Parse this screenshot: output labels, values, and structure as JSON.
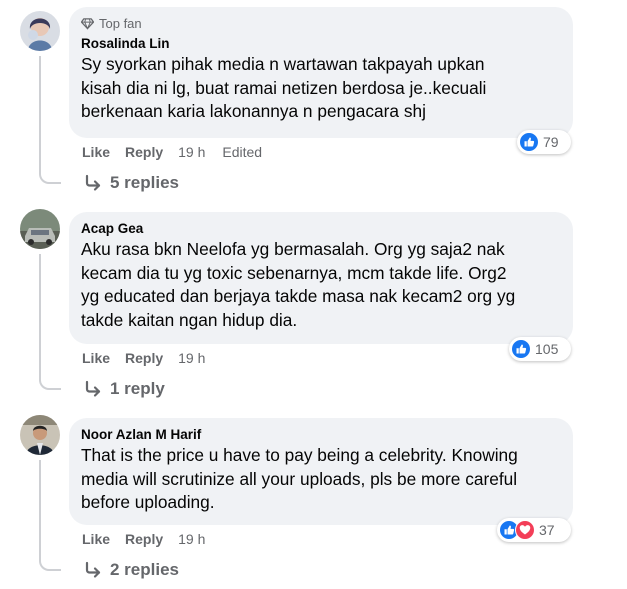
{
  "ui": {
    "like_label": "Like",
    "reply_label": "Reply"
  },
  "comments": [
    {
      "badge": "Top fan",
      "author": "Rosalinda Lin",
      "text": "Sy syorkan pihak media n wartawan takpayah upkan\nkisah dia ni lg, buat ramai netizen berdosa je..kecuali\nberkenaan karia lakonannya n pengacara shj",
      "time": "19 h",
      "edited": "Edited",
      "reaction_count": "79",
      "reactions": [
        "like"
      ],
      "replies": "5 replies"
    },
    {
      "author": "Acap Gea",
      "text": "Aku rasa bkn Neelofa yg bermasalah. Org yg saja2 nak\nkecam dia tu yg toxic sebenarnya, mcm takde life. Org2\nyg educated dan berjaya takde masa nak kecam2 org yg\ntakde kaitan ngan hidup dia.",
      "time": "19 h",
      "reaction_count": "105",
      "reactions": [
        "like"
      ],
      "replies": "1 reply"
    },
    {
      "author": "Noor Azlan M Harif",
      "text": "That is the price u have to pay being a celebrity. Knowing\nmedia will scrutinize all your uploads, pls be more careful\nbefore uploading.",
      "time": "19 h",
      "reaction_count": "37",
      "reactions": [
        "like",
        "love"
      ],
      "replies": "2 replies"
    }
  ],
  "colors": {
    "bubble": "#f0f2f5",
    "secondary_text": "#65676b",
    "like_blue": "#1877f2",
    "love_red": "#f33e58",
    "thread_line": "#ced0d4"
  }
}
